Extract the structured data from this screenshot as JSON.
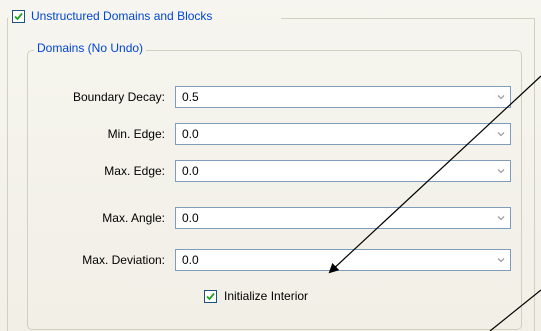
{
  "section": {
    "title": "Unstructured Domains and Blocks",
    "checked": true
  },
  "group": {
    "title": "Domains (No Undo)"
  },
  "fields": [
    {
      "label": "Boundary Decay:",
      "value": "0.5"
    },
    {
      "label": "Min. Edge:",
      "value": "0.0"
    },
    {
      "label": "Max. Edge:",
      "value": "0.0"
    },
    {
      "label": "Max. Angle:",
      "value": "0.0"
    },
    {
      "label": "Max. Deviation:",
      "value": "0.0"
    }
  ],
  "initialize_interior": {
    "label": "Initialize Interior",
    "checked": true
  },
  "colors": {
    "accent_text": "#0046d5",
    "checkbox_border": "#1c5180",
    "checkmark": "#21a121",
    "field_border": "#7f9db9"
  }
}
